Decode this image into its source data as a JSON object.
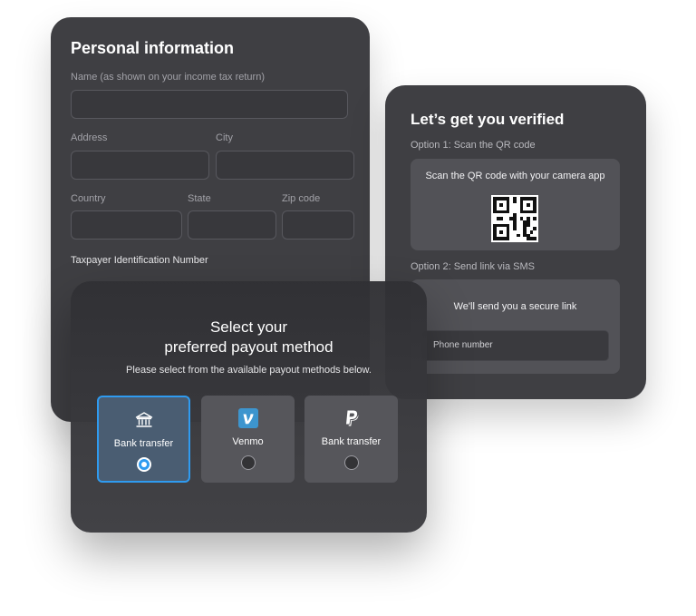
{
  "personal_info": {
    "title": "Personal information",
    "name_label": "Name (as shown on your income tax return)",
    "address_label": "Address",
    "city_label": "City",
    "country_label": "Country",
    "state_label": "State",
    "zip_label": "Zip code",
    "tin_label": "Taxpayer Identification Number"
  },
  "verify": {
    "title": "Let’s get you verified",
    "option1_label": "Option 1: Scan the QR code",
    "qr_text": "Scan the QR code with your camera app",
    "qr_icon": "qr-code-icon",
    "option2_label": "Option 2: Send link via SMS",
    "sms_text": "We'll send you a secure link",
    "phone_placeholder": "Phone number"
  },
  "payout": {
    "title_line1": "Select your",
    "title_line2": "preferred payout method",
    "subtitle": "Please select from the available payout methods below.",
    "methods": [
      {
        "label": "Bank transfer",
        "icon": "bank-icon",
        "selected": true
      },
      {
        "label": "Venmo",
        "icon": "venmo-icon",
        "selected": false
      },
      {
        "label": "Bank transfer",
        "icon": "paypal-icon",
        "selected": false
      }
    ]
  },
  "colors": {
    "card_bg": "#3f3f43",
    "accent": "#2f9bf0",
    "venmo": "#3d95ce"
  }
}
